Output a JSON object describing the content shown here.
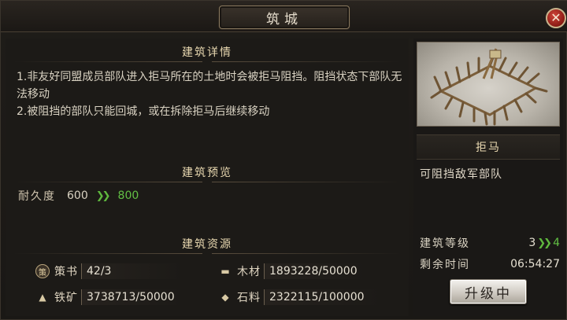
{
  "window": {
    "title": "筑城",
    "close_icon": "close-icon"
  },
  "details": {
    "heading": "建筑详情",
    "lines": [
      "1.非友好同盟成员部队进入拒马所在的土地时会被拒马阻挡。阻挡状态下部队无法移动",
      "2.被阻挡的部队只能回城，或在拆除拒马后继续移动"
    ]
  },
  "preview": {
    "heading": "建筑预览",
    "durability_label": "耐久度",
    "current": "600",
    "next": "800"
  },
  "resources": {
    "heading": "建筑资源",
    "items": [
      {
        "icon": "command-book-icon",
        "name": "策书",
        "value": "42/3"
      },
      {
        "icon": "wood-icon",
        "name": "木材",
        "value": "1893228/50000"
      },
      {
        "icon": "iron-icon",
        "name": "铁矿",
        "value": "3738713/50000"
      },
      {
        "icon": "stone-icon",
        "name": "石料",
        "value": "2322115/100000"
      }
    ]
  },
  "building": {
    "name": "拒马",
    "description": "可阻挡敌军部队",
    "level_label": "建筑等级",
    "level_current": "3",
    "level_next": "4",
    "time_label": "剩余时间",
    "time_value": "06:54:27",
    "button_label": "升级中"
  },
  "colors": {
    "accent_green": "#62c044",
    "heading": "#e8d8b0"
  }
}
